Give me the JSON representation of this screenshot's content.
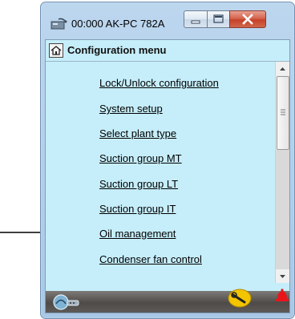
{
  "window": {
    "title": "00:000 AK-PC 782A",
    "icons": {
      "app": "network-device-icon",
      "minimize": "minimize-icon",
      "maximize": "maximize-icon",
      "close": "close-icon"
    }
  },
  "header": {
    "title": "Configuration menu",
    "icon": "home-icon"
  },
  "menu": {
    "items": [
      {
        "label": "Lock/Unlock configuration"
      },
      {
        "label": "System setup"
      },
      {
        "label": "Select plant type"
      },
      {
        "label": "Suction group MT"
      },
      {
        "label": "Suction group LT"
      },
      {
        "label": "Suction group IT"
      },
      {
        "label": "Oil management"
      },
      {
        "label": "Condenser fan control"
      }
    ]
  },
  "annotation": {
    "arrow_target": "Oil management"
  },
  "statusbar": {
    "icons": [
      "login-icon",
      "service-wrench-icon",
      "alarm-bell-icon"
    ],
    "alarm_color": "#e8161a",
    "service_color": "#f3c400"
  },
  "colors": {
    "client_bg": "#c6eefa",
    "statusbar_bg": "#55524f"
  }
}
